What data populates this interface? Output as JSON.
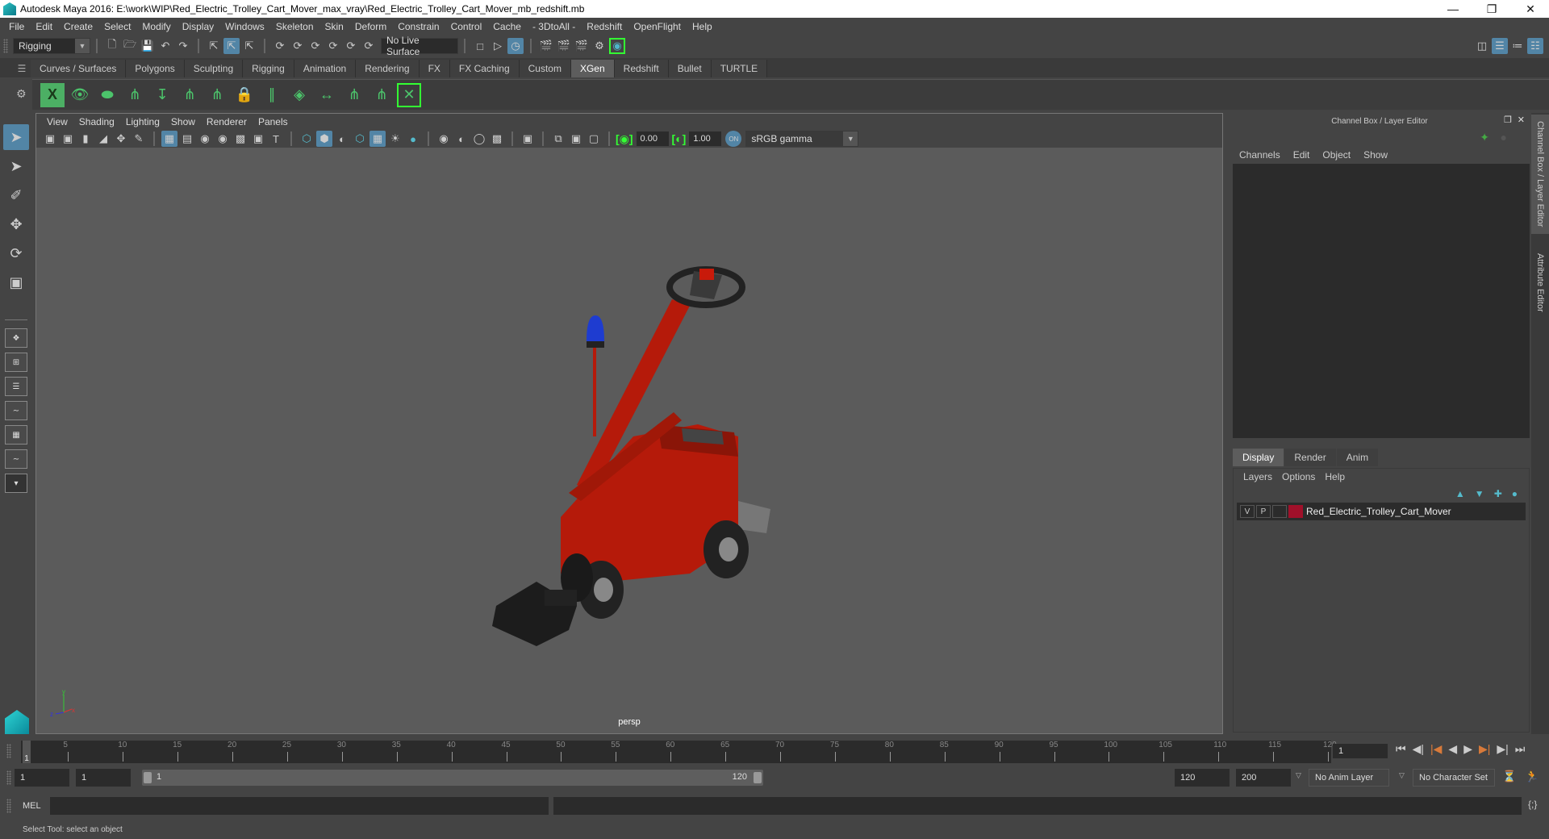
{
  "window": {
    "title": "Autodesk Maya 2016: E:\\work\\WIP\\Red_Electric_Trolley_Cart_Mover_max_vray\\Red_Electric_Trolley_Cart_Mover_mb_redshift.mb",
    "minimize_icon": "minimize-icon",
    "restore_icon": "restore-icon",
    "close_icon": "close-icon"
  },
  "menubar": [
    "File",
    "Edit",
    "Create",
    "Select",
    "Modify",
    "Display",
    "Windows",
    "Skeleton",
    "Skin",
    "Deform",
    "Constrain",
    "Control",
    "Cache",
    "- 3DtoAll -",
    "Redshift",
    "OpenFlight",
    "Help"
  ],
  "statusline": {
    "menuset": "Rigging",
    "live_surface": "No Live Surface"
  },
  "shelf": {
    "tabs": [
      "Curves / Surfaces",
      "Polygons",
      "Sculpting",
      "Rigging",
      "Animation",
      "Rendering",
      "FX",
      "FX Caching",
      "Custom",
      "XGen",
      "Redshift",
      "Bullet",
      "TURTLE"
    ],
    "active_tab": "XGen",
    "icons": [
      "xgen-window-icon",
      "preview-icon",
      "clear-preview-icon",
      "add-description-icon",
      "place-guide-icon",
      "add-guide-icon",
      "guide-visibility-icon",
      "lock-guide-icon",
      "split-guide-icon",
      "grid-icon",
      "flip-guide-icon",
      "select-guide-icon",
      "guide-rig-icon",
      "sculpt-guide-icon"
    ]
  },
  "viewport": {
    "menu": [
      "View",
      "Shading",
      "Lighting",
      "Show",
      "Renderer",
      "Panels"
    ],
    "exposure": "0.00",
    "gamma": "1.00",
    "color_space": "sRGB gamma",
    "camera_label": "persp",
    "model_colors": {
      "body": "#b51a0a",
      "light": "#1e3cd0",
      "tire": "#222222"
    }
  },
  "channel_box": {
    "title": "Channel Box / Layer Editor",
    "menu": [
      "Channels",
      "Edit",
      "Object",
      "Show"
    ]
  },
  "layer_editor": {
    "tabs": [
      "Display",
      "Render",
      "Anim"
    ],
    "active_tab": "Display",
    "menu": [
      "Layers",
      "Options",
      "Help"
    ],
    "layers": [
      {
        "visible": "V",
        "playback": "P",
        "color": "#a0102a",
        "name": "Red_Electric_Trolley_Cart_Mover"
      }
    ]
  },
  "side_tabs": [
    "Channel Box / Layer Editor",
    "Attribute Editor"
  ],
  "timeline": {
    "ticks": [
      1,
      5,
      10,
      15,
      20,
      25,
      30,
      35,
      40,
      45,
      50,
      55,
      60,
      65,
      70,
      75,
      80,
      85,
      90,
      95,
      100,
      105,
      110,
      115,
      120
    ],
    "current_frame": "1"
  },
  "range": {
    "start": "1",
    "playback_start": "1",
    "slider_start": "1",
    "slider_end": "120",
    "playback_end": "120",
    "end": "200",
    "anim_layer": "No Anim Layer",
    "character_set": "No Character Set"
  },
  "command_line": {
    "label": "MEL"
  },
  "help_line": "Select Tool: select an object"
}
